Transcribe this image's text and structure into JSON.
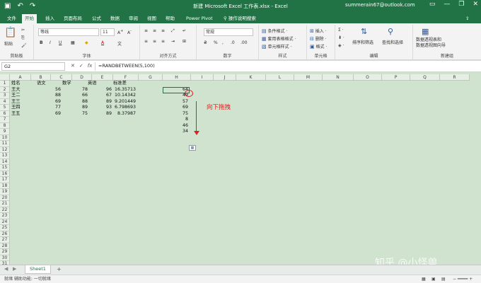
{
  "titlebar": {
    "doc_title": "新建 Microsoft Excel 工作表.xlsx  -  Excel",
    "user": "summerain67@outlook.com",
    "save_icon": "save-icon",
    "undo_icon": "undo-icon",
    "redo_icon": "redo-icon"
  },
  "tabs": [
    "文件",
    "开始",
    "插入",
    "页面布局",
    "公式",
    "数据",
    "审阅",
    "视图",
    "帮助",
    "Power Pivot",
    "操作说明搜索"
  ],
  "active_tab": "开始",
  "ribbon": {
    "clipboard": {
      "label": "剪贴板",
      "paste": "粘贴"
    },
    "font": {
      "label": "字体",
      "name": "等线",
      "size": "11",
      "bold": "B",
      "italic": "I",
      "underline": "U"
    },
    "align": {
      "label": "对齐方式"
    },
    "number": {
      "label": "数字",
      "format": "常规"
    },
    "styles": {
      "label": "样式",
      "cond": "条件格式 ·",
      "table": "套用表格格式 ·",
      "cell": "单元格样式 ·"
    },
    "cells": {
      "label": "单元格",
      "insert": "插入 ·",
      "delete": "删除 ·",
      "format": "格式 ·"
    },
    "editing": {
      "label": "编辑",
      "sort": "排序和筛选",
      "find": "查找和选择"
    },
    "new": {
      "label": "新建组",
      "pivot1": "数据透视表和",
      "pivot2": "数据透视图向导"
    }
  },
  "formula_bar": {
    "name_box": "G2",
    "fx": "fx",
    "formula": "=RANDBETWEEN(5,100)"
  },
  "columns": [
    "A",
    "B",
    "C",
    "D",
    "E",
    "F",
    "G",
    "H",
    "I",
    "J",
    "K",
    "L",
    "M",
    "N",
    "O",
    "P",
    "Q",
    "R"
  ],
  "rows": [
    "1",
    "2",
    "3",
    "4",
    "5",
    "6",
    "7",
    "8",
    "9",
    "10",
    "11",
    "12",
    "13",
    "14",
    "15",
    "16",
    "17",
    "18",
    "19",
    "20",
    "21",
    "22",
    "23",
    "24",
    "25",
    "26",
    "27",
    "28",
    "29",
    "30",
    "31"
  ],
  "headers": [
    "姓名",
    "语文",
    "数学",
    "英语",
    "标准差"
  ],
  "table": [
    [
      "王大",
      "56",
      "78",
      "96",
      "16.35713"
    ],
    [
      "王二",
      "88",
      "66",
      "67",
      "10.14342"
    ],
    [
      "王三",
      "69",
      "88",
      "89",
      "9.201449"
    ],
    [
      "王四",
      "77",
      "89",
      "93",
      "6.798693"
    ],
    [
      "王五",
      "69",
      "75",
      "89",
      "8.37987"
    ]
  ],
  "g_column": [
    "64",
    "49",
    "57",
    "69",
    "75",
    "8",
    "46",
    "34"
  ],
  "annotation": "向下拖拽",
  "sheet": {
    "name": "Sheet1",
    "add": "+"
  },
  "status": {
    "text": "就绪  辅助功能: 一切就绪"
  },
  "watermark": "知乎 @小怪兽",
  "colors": {
    "excel_green": "#217346",
    "grid_bg": "#cfe3cf",
    "annotation_red": "#e02020"
  }
}
